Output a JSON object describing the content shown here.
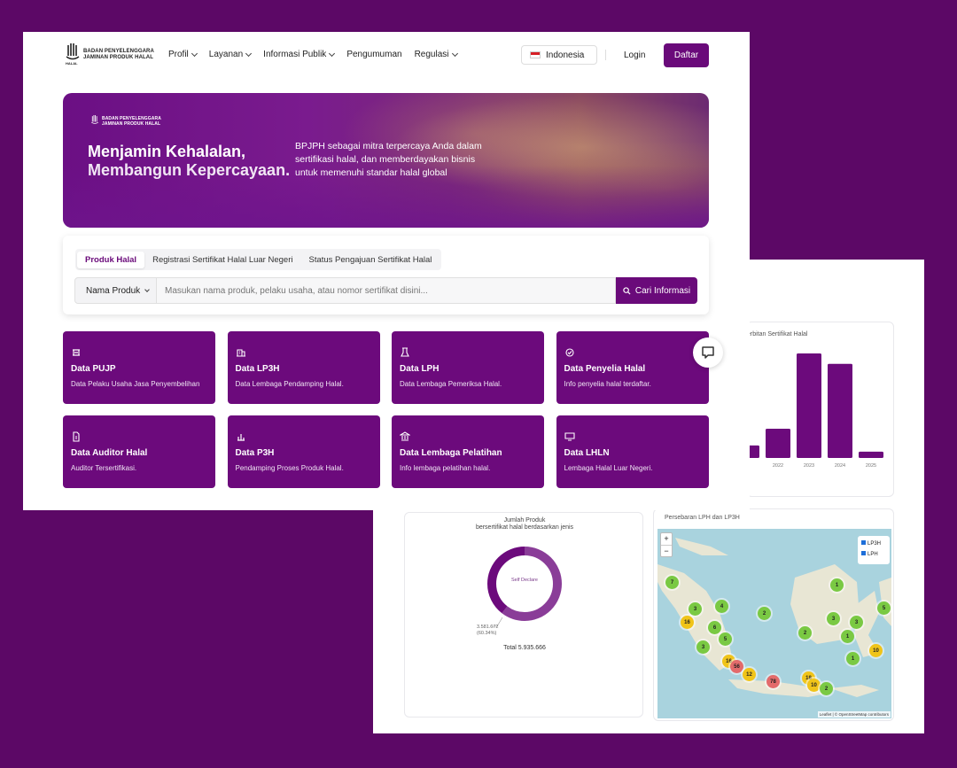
{
  "nav": {
    "logo_line1": "BADAN PENYELENGGARA",
    "logo_line2": "JAMINAN PRODUK HALAL",
    "logo_mark_text": "HALAL",
    "items": [
      "Profil",
      "Layanan",
      "Informasi Publik",
      "Pengumuman",
      "Regulasi"
    ],
    "language": "Indonesia",
    "login": "Login",
    "register": "Daftar"
  },
  "hero": {
    "logo_line1": "BADAN PENYELENGGARA",
    "logo_line2": "JAMINAN PRODUK HALAL",
    "title_line1": "Menjamin Kehalalan,",
    "title_line2": "Membangun Kepercayaan.",
    "description": "BPJPH sebagai mitra terpercaya Anda dalam sertifikasi halal, dan memberdayakan bisnis untuk memenuhi standar halal global"
  },
  "search": {
    "tabs": [
      "Produk Halal",
      "Registrasi Sertifikat Halal Luar Negeri",
      "Status Pengajuan Sertifikat Halal"
    ],
    "active_tab": "Produk Halal",
    "select_value": "Nama Produk",
    "placeholder": "Masukan nama produk, pelaku usaha, atau nomor sertifikat disini...",
    "button": "Cari Informasi"
  },
  "tiles": [
    {
      "icon": "slaughter-icon",
      "title": "Data PUJP",
      "desc": "Data Pelaku Usaha Jasa Penyembelihan"
    },
    {
      "icon": "building-icon",
      "title": "Data LP3H",
      "desc": "Data Lembaga Pendamping Halal."
    },
    {
      "icon": "lab-icon",
      "title": "Data LPH",
      "desc": "Data Lembaga Pemeriksa Halal."
    },
    {
      "icon": "badge-icon",
      "title": "Data Penyelia Halal",
      "desc": "Info penyelia halal terdaftar."
    },
    {
      "icon": "document-icon",
      "title": "Data Auditor Halal",
      "desc": "Auditor Tersertifikasi."
    },
    {
      "icon": "chart-icon",
      "title": "Data P3H",
      "desc": "Pendamping Proses Produk Halal."
    },
    {
      "icon": "institution-icon",
      "title": "Data Lembaga Pelatihan",
      "desc": "Info lembaga pelatihan halal."
    },
    {
      "icon": "monitor-icon",
      "title": "Data LHLN",
      "desc": "Lembaga Halal Luar Negeri."
    }
  ],
  "chart_data": [
    {
      "type": "bar",
      "title": "erbitan Sertifikat Halal",
      "categories": [
        "",
        "2022",
        "2023",
        "2024",
        "2025"
      ],
      "values": [
        0.12,
        0.28,
        1.0,
        0.9,
        0.06
      ],
      "color": "#6c0a7c"
    },
    {
      "type": "pie",
      "title_line1": "Jumlah Produk",
      "title_line2": "bersertifikat halal berdasarkan jenis",
      "center_label": "Self Declare",
      "slices": [
        {
          "value": 0.6034,
          "color": "#8a3d98"
        },
        {
          "value": 0.3966,
          "color": "#6c0a7c"
        }
      ],
      "annotation_value": "3.581.672",
      "annotation_percent": "(60.34%)",
      "total": "Total 5.935.666"
    }
  ],
  "map": {
    "title": "Persebaran LPH dan LP3H",
    "legend": [
      "LP3H",
      "LPH"
    ],
    "zoom_in": "+",
    "zoom_out": "−",
    "attribution": "Leaflet | © OpenStreetMap contributors",
    "markers": [
      "7",
      "1",
      "3",
      "4",
      "2",
      "16",
      "6",
      "5",
      "3",
      "3",
      "5",
      "2",
      "1",
      "3",
      "10",
      "16",
      "56",
      "12",
      "78",
      "18",
      "1",
      "10",
      "2"
    ]
  }
}
